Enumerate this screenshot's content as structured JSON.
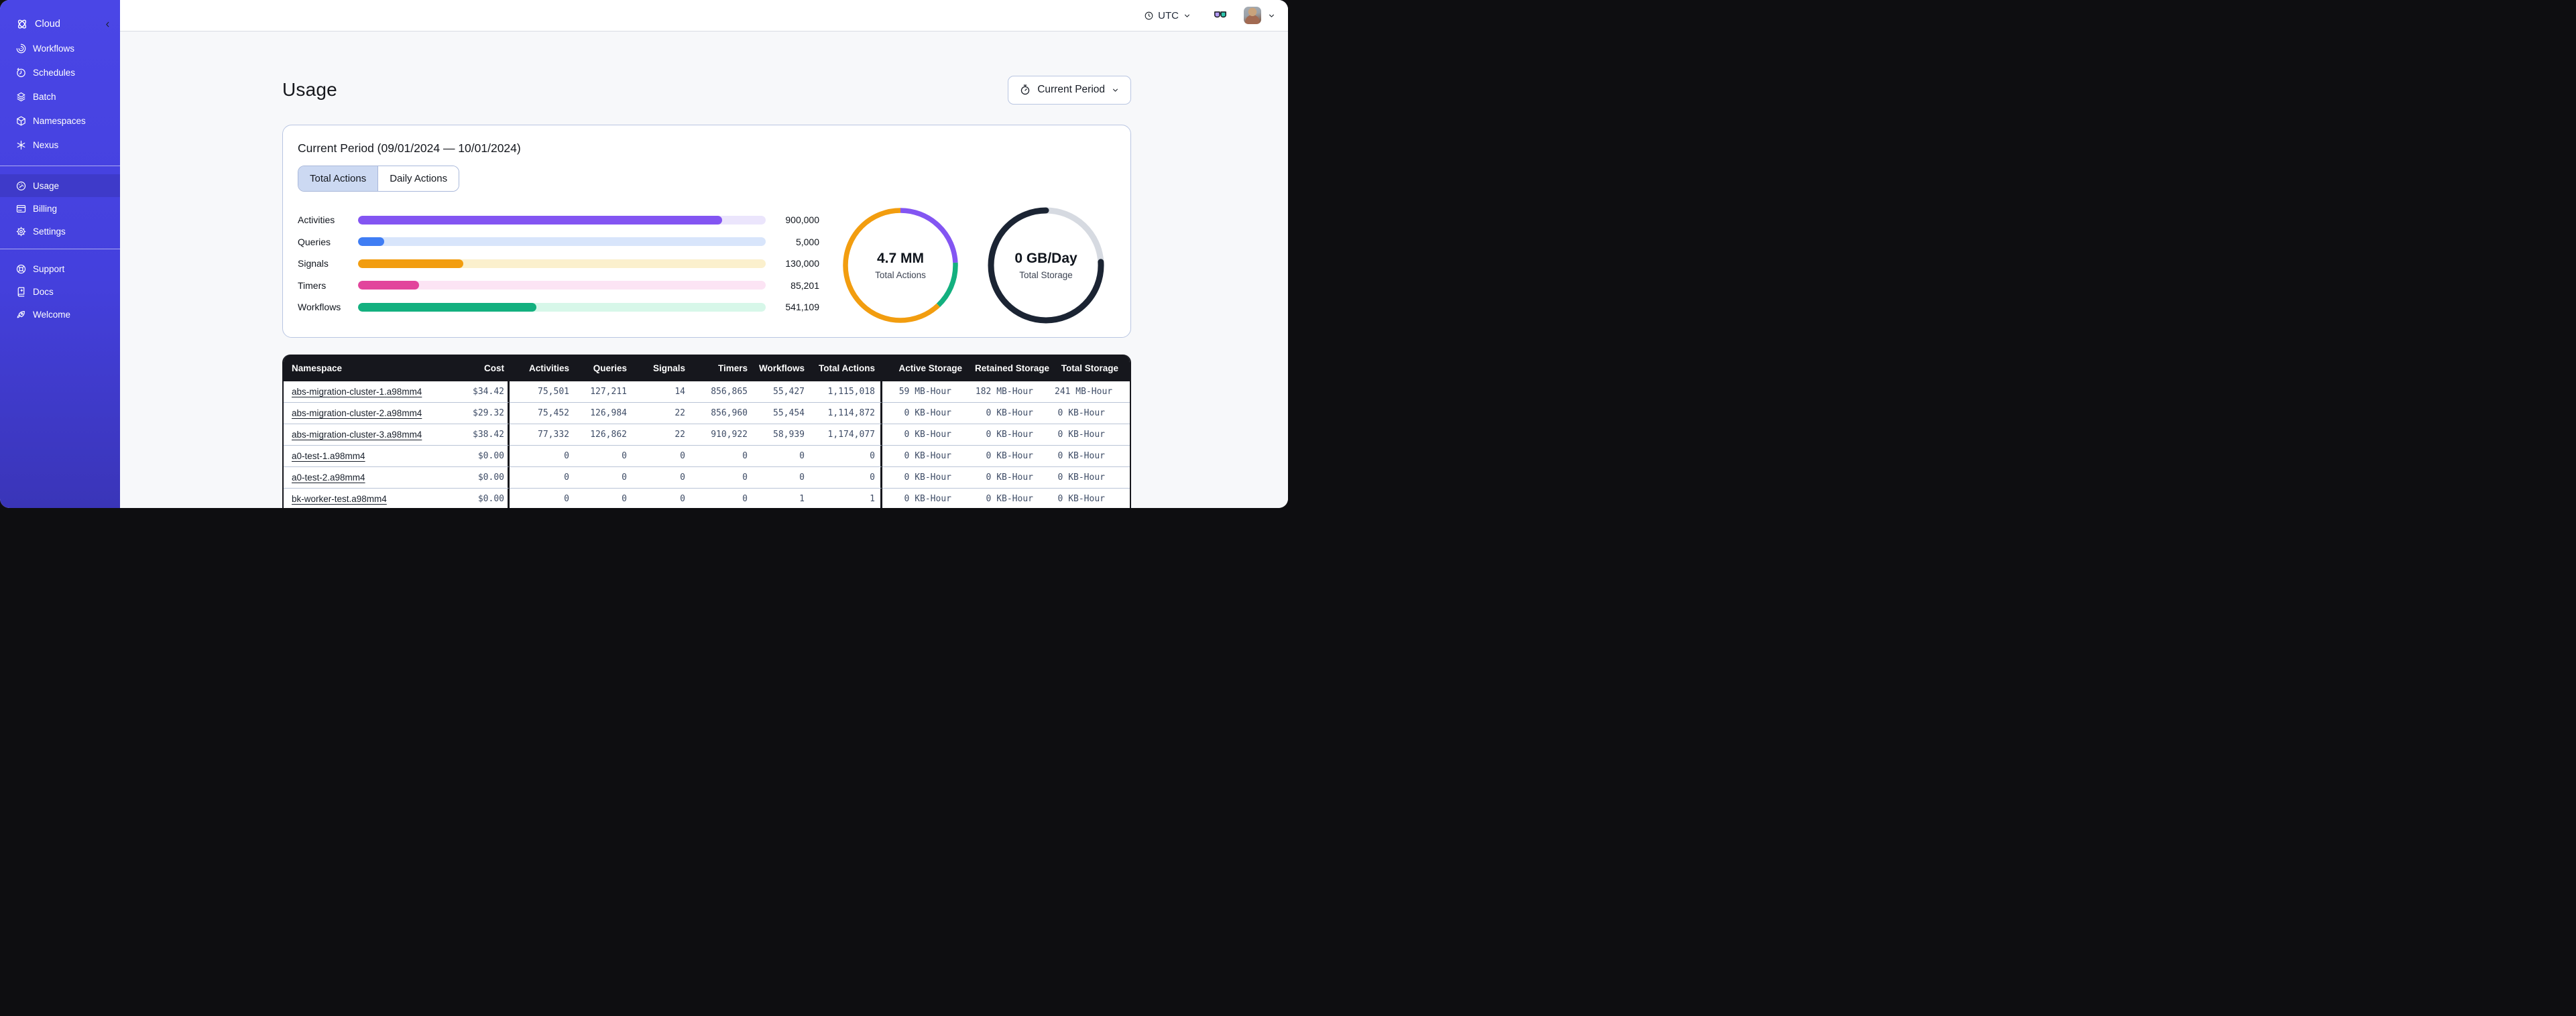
{
  "sidebar": {
    "brand": {
      "label": "Cloud",
      "icon": "temporal-logo"
    },
    "sections": [
      {
        "items": [
          {
            "label": "Workflows",
            "icon": "workflows",
            "active": false
          },
          {
            "label": "Schedules",
            "icon": "schedules",
            "active": false
          },
          {
            "label": "Batch",
            "icon": "batch",
            "active": false
          },
          {
            "label": "Namespaces",
            "icon": "namespaces",
            "active": false
          },
          {
            "label": "Nexus",
            "icon": "nexus",
            "active": false
          }
        ]
      },
      {
        "items": [
          {
            "label": "Usage",
            "icon": "usage",
            "active": true
          },
          {
            "label": "Billing",
            "icon": "billing",
            "active": false
          },
          {
            "label": "Settings",
            "icon": "settings",
            "active": false
          }
        ]
      },
      {
        "items": [
          {
            "label": "Support",
            "icon": "support",
            "active": false
          },
          {
            "label": "Docs",
            "icon": "docs",
            "active": false
          },
          {
            "label": "Welcome",
            "icon": "welcome",
            "active": false
          }
        ]
      }
    ],
    "colors": {
      "background_top": "#4a46e6",
      "background_bottom": "#3a35b8",
      "active_item": "#3e3ac9"
    }
  },
  "topbar": {
    "timezone": "UTC"
  },
  "page": {
    "title": "Usage",
    "period_button_label": "Current Period"
  },
  "usage_card": {
    "title": "Current Period (09/01/2024 — 10/01/2024)",
    "tabs": [
      {
        "label": "Total Actions",
        "active": true
      },
      {
        "label": "Daily Actions",
        "active": false
      }
    ]
  },
  "chart_data": [
    {
      "type": "bar",
      "orientation": "horizontal",
      "categories": [
        "Activities",
        "Queries",
        "Signals",
        "Timers",
        "Workflows"
      ],
      "values": [
        900000,
        5000,
        130000,
        85201,
        541109
      ],
      "value_labels": [
        "900,000",
        "5,000",
        "130,000",
        "85,201",
        "541,109"
      ],
      "fill_percent": [
        89.3,
        6.4,
        25.8,
        15.0,
        43.8
      ],
      "bar_colors": [
        "#8355f2",
        "#3f7df4",
        "#f29d0f",
        "#e2459c",
        "#13b07f"
      ],
      "track_colors": [
        "#ebe5fc",
        "#d8e5fb",
        "#fbf0cd",
        "#fce4f4",
        "#d7f7e9"
      ],
      "title": "Current Period usage by action type",
      "xlabel": "",
      "ylabel": "",
      "grid": false
    },
    {
      "type": "pie",
      "subtype": "donut",
      "center_value": "4.7 MM",
      "center_label": "Total Actions",
      "thickness": 7.5,
      "slices": [
        {
          "name": "segment-purple",
          "percent": 24.2,
          "color": "#8355f2"
        },
        {
          "name": "segment-green",
          "percent": 13.7,
          "color": "#13b07f"
        },
        {
          "name": "segment-orange",
          "percent": 62.1,
          "color": "#f29d0f"
        }
      ]
    },
    {
      "type": "pie",
      "subtype": "donut",
      "center_value": "0 GB/Day",
      "center_label": "Total Storage",
      "thickness": 9,
      "slices": [
        {
          "name": "segment-empty",
          "percent": 24,
          "color": "#d6dae1"
        },
        {
          "name": "segment-dark",
          "percent": 76,
          "color": "#1b2433",
          "rounded_cap": true
        }
      ]
    }
  ],
  "table": {
    "columns": [
      "Namespace",
      "Cost",
      "Activities",
      "Queries",
      "Signals",
      "Timers",
      "Workflows",
      "Total Actions",
      "Active Storage",
      "Retained Storage",
      "Total Storage"
    ],
    "rows": [
      [
        "abs-migration-cluster-1.a98mm4",
        "$34.42",
        "75,501",
        "127,211",
        "14",
        "856,865",
        "55,427",
        "1,115,018",
        "59 MB-Hour",
        "182 MB-Hour",
        "241 MB-Hour"
      ],
      [
        "abs-migration-cluster-2.a98mm4",
        "$29.32",
        "75,452",
        "126,984",
        "22",
        "856,960",
        "55,454",
        "1,114,872",
        "0 KB-Hour",
        "0 KB-Hour",
        "0 KB-Hour"
      ],
      [
        "abs-migration-cluster-3.a98mm4",
        "$38.42",
        "77,332",
        "126,862",
        "22",
        "910,922",
        "58,939",
        "1,174,077",
        "0 KB-Hour",
        "0 KB-Hour",
        "0 KB-Hour"
      ],
      [
        "a0-test-1.a98mm4",
        "$0.00",
        "0",
        "0",
        "0",
        "0",
        "0",
        "0",
        "0 KB-Hour",
        "0 KB-Hour",
        "0 KB-Hour"
      ],
      [
        "a0-test-2.a98mm4",
        "$0.00",
        "0",
        "0",
        "0",
        "0",
        "0",
        "0",
        "0 KB-Hour",
        "0 KB-Hour",
        "0 KB-Hour"
      ],
      [
        "bk-worker-test.a98mm4",
        "$0.00",
        "0",
        "0",
        "0",
        "0",
        "1",
        "1",
        "0 KB-Hour",
        "0 KB-Hour",
        "0 KB-Hour"
      ]
    ]
  }
}
